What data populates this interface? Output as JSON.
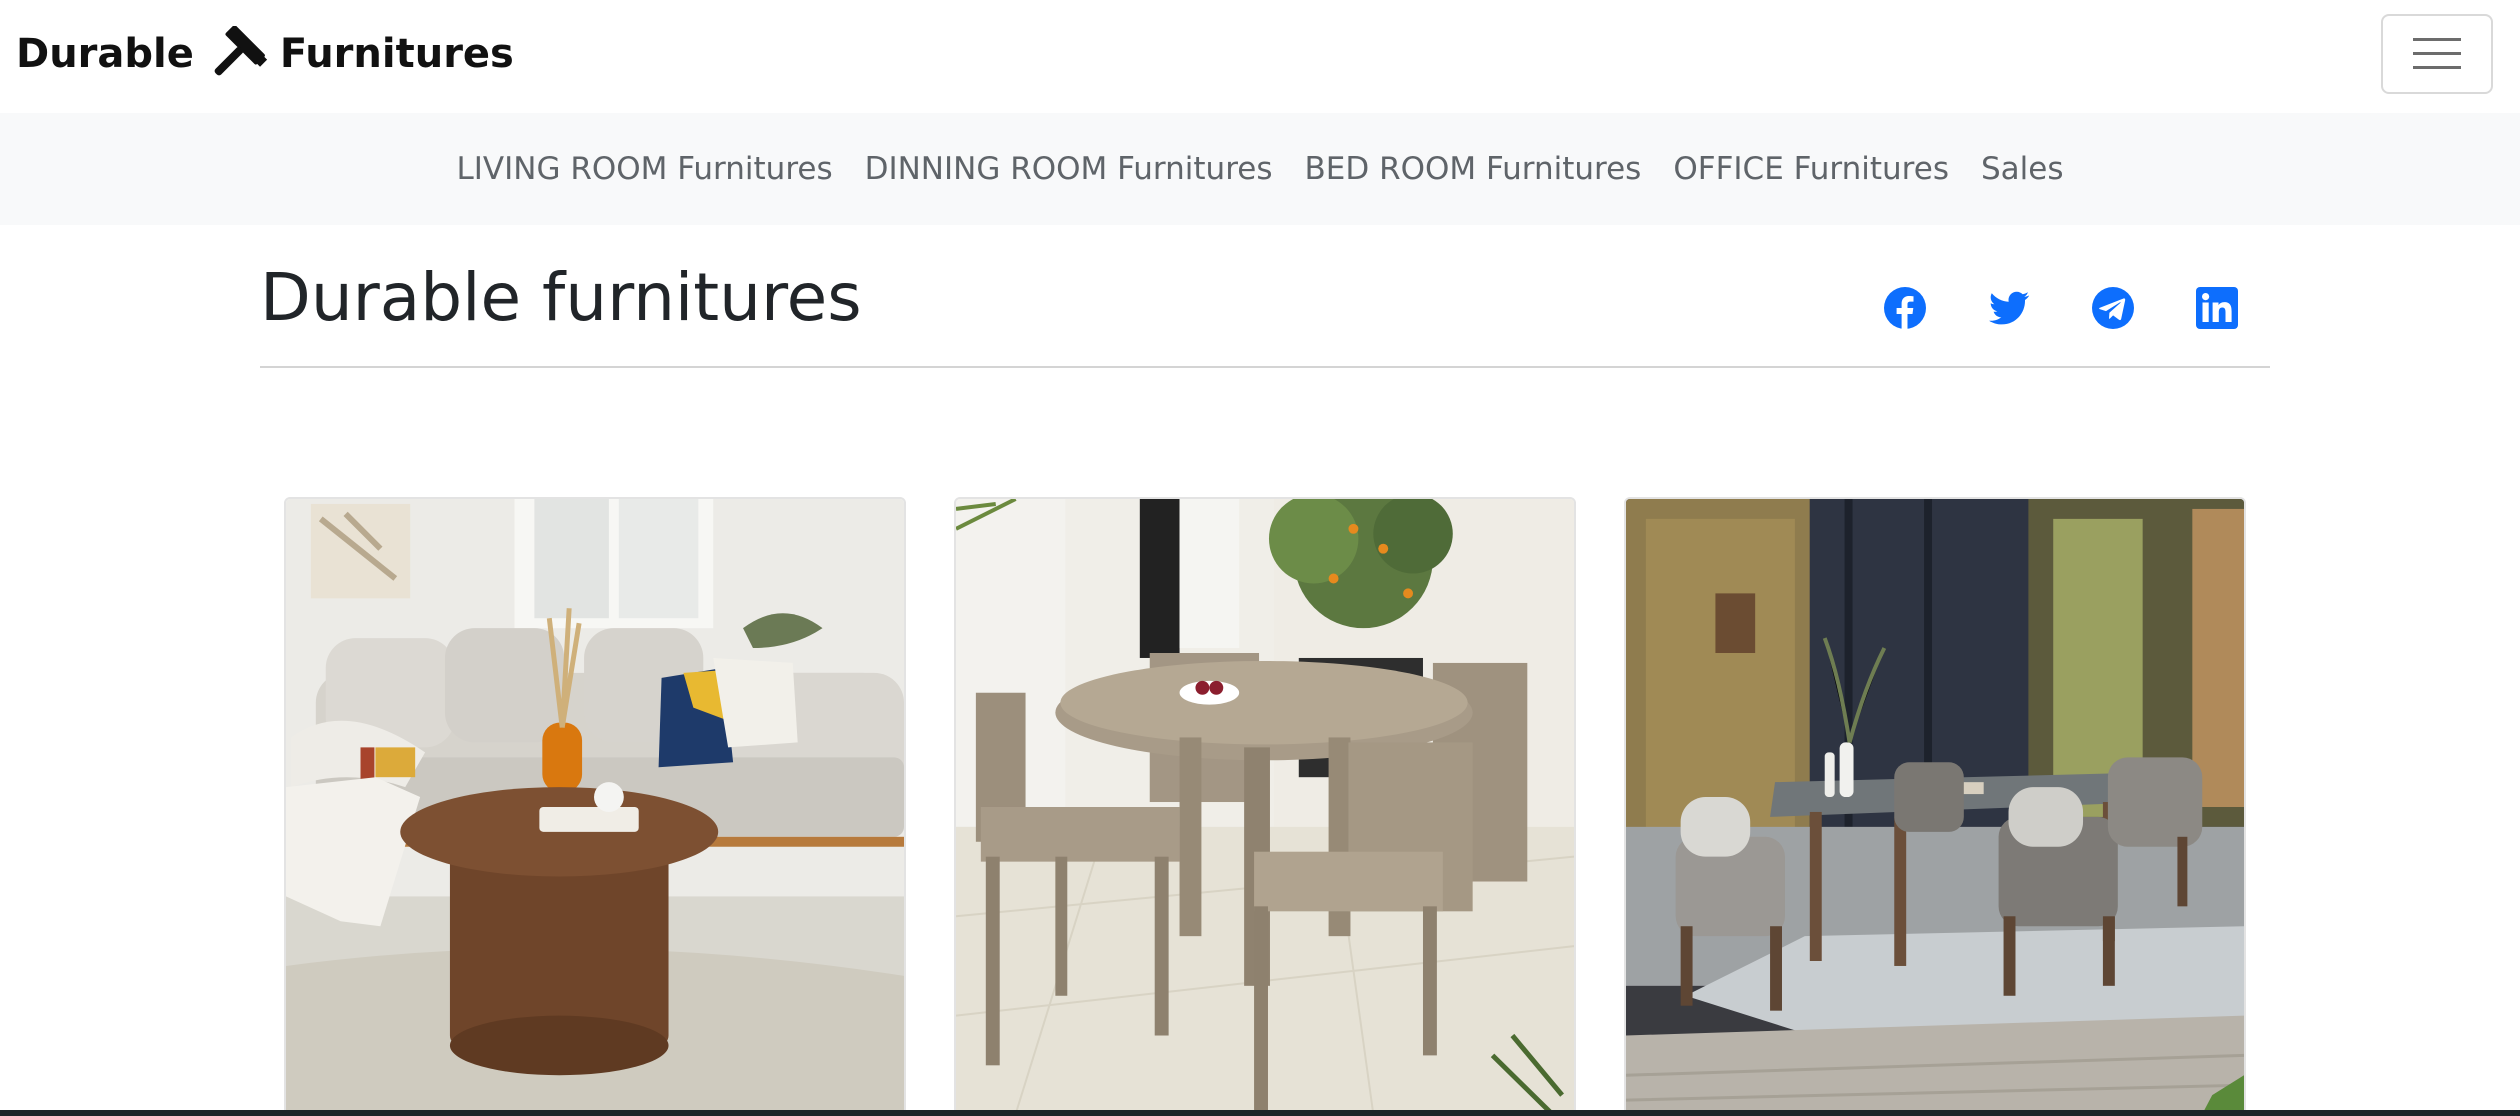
{
  "brand": {
    "word1": "Durable",
    "word2": "Furnitures",
    "icon": "hammer-icon"
  },
  "nav": {
    "items": [
      {
        "label": "LIVING ROOM Furnitures"
      },
      {
        "label": "DINNING ROOM Furnitures"
      },
      {
        "label": "BED ROOM Furnitures"
      },
      {
        "label": "OFFICE Furnitures"
      },
      {
        "label": "Sales"
      }
    ],
    "toggler_icon": "hamburger-icon"
  },
  "page": {
    "title": "Durable furnitures"
  },
  "social": {
    "icons": [
      "facebook-icon",
      "twitter-icon",
      "telegram-icon",
      "linkedin-icon"
    ],
    "color": "#0d6efd"
  },
  "cards": [
    {
      "image": "living-room-sofa-coffee-table-photo"
    },
    {
      "image": "outdoor-round-wooden-dining-set-photo"
    },
    {
      "image": "patio-dining-table-on-deck-photo"
    }
  ],
  "colors": {
    "subnav_bg": "#f8f9fa",
    "subnav_text": "#5f6469",
    "accent": "#0d6efd"
  }
}
